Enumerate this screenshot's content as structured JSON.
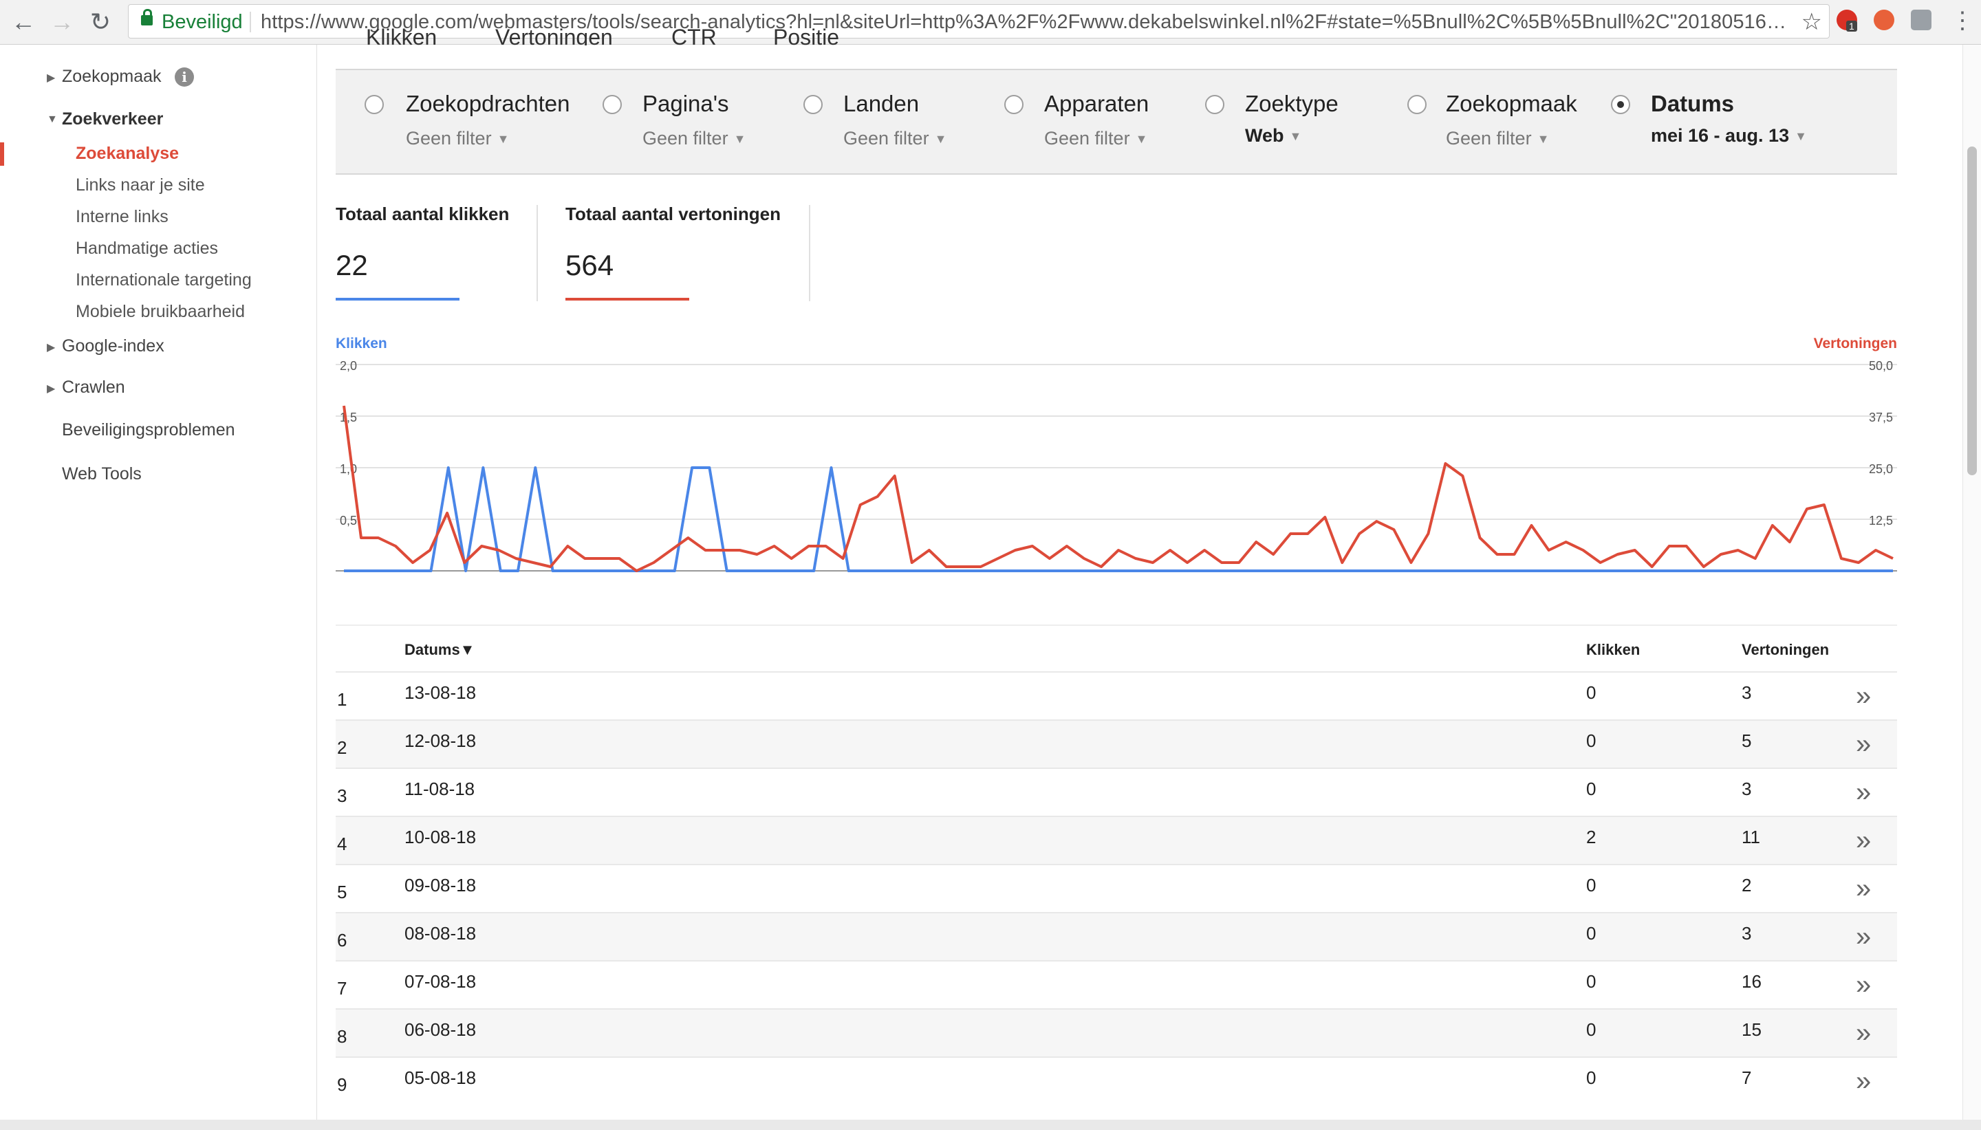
{
  "browser": {
    "back_icon": "back-arrow-icon",
    "forward_icon": "forward-arrow-icon",
    "reload_icon": "reload-icon",
    "secure_label": "Beveiligd",
    "url": "https://www.google.com/webmasters/tools/search-analytics?hl=nl&siteUrl=http%3A%2F%2Fwww.dekabelswinkel.nl%2F#state=%5Bnull%2C%5B%5Bnull%2C\"20180516…",
    "extension_badge": "1"
  },
  "sidebar": {
    "items": [
      {
        "label": "Zoekopmaak",
        "expandable": true
      },
      {
        "label": "Zoekverkeer",
        "expanded": true,
        "children": [
          "Zoekanalyse",
          "Links naar je site",
          "Interne links",
          "Handmatige acties",
          "Internationale targeting",
          "Mobiele bruikbaarheid"
        ]
      },
      {
        "label": "Google-index",
        "expandable": true
      },
      {
        "label": "Crawlen",
        "expandable": true
      },
      {
        "label": "Beveiligingsproblemen"
      },
      {
        "label": "Web Tools"
      }
    ],
    "active_child": "Zoekanalyse",
    "info_glyph": "i"
  },
  "metric_checkboxes": [
    "Klikken",
    "Vertoningen",
    "CTR",
    "Positie"
  ],
  "filters": [
    {
      "label": "Zoekopdrachten",
      "value": "Geen filter"
    },
    {
      "label": "Pagina's",
      "value": "Geen filter"
    },
    {
      "label": "Landen",
      "value": "Geen filter"
    },
    {
      "label": "Apparaten",
      "value": "Geen filter"
    },
    {
      "label": "Zoektype",
      "value": "Web"
    },
    {
      "label": "Zoekopmaak",
      "value": "Geen filter"
    },
    {
      "label": "Datums",
      "value": "mei 16 - aug. 13",
      "selected": true
    }
  ],
  "metrics": {
    "clicks_label": "Totaal aantal klikken",
    "clicks_value": "22",
    "impressions_label": "Totaal aantal vertoningen",
    "impressions_value": "564"
  },
  "chart_data": {
    "type": "line",
    "y_left_label": "Klikken",
    "y_right_label": "Vertoningen",
    "y_left_ticks": [
      "0,5",
      "1,0",
      "1,5",
      "2,0"
    ],
    "y_right_ticks": [
      "12,5",
      "25,0",
      "37,5",
      "50,0"
    ],
    "ylim_left": [
      0,
      2
    ],
    "ylim_right": [
      0,
      50
    ],
    "x_start": "2018-05-16",
    "x_end": "2018-08-13",
    "colors": {
      "clicks": "#4a86e8",
      "impressions": "#dd4b39"
    },
    "series": [
      {
        "name": "Klikken",
        "values": [
          0,
          0,
          0,
          0,
          0,
          0,
          1,
          0,
          1,
          0,
          0,
          1,
          0,
          0,
          0,
          0,
          0,
          0,
          0,
          0,
          1,
          1,
          0,
          0,
          0,
          0,
          0,
          0,
          1,
          0,
          0,
          0,
          0,
          0,
          0,
          0,
          0,
          0,
          0,
          0,
          0,
          0,
          0,
          0,
          0,
          0,
          0,
          0,
          0,
          0,
          0,
          0,
          0,
          0,
          0,
          0,
          0,
          0,
          0,
          0,
          0,
          0,
          0,
          0,
          0,
          0,
          0,
          0,
          0,
          0,
          0,
          0,
          0,
          0,
          0,
          0,
          0,
          0,
          0,
          0,
          0,
          0,
          0,
          0,
          0,
          0,
          0,
          0,
          0,
          0
        ]
      },
      {
        "name": "Vertoningen",
        "values": [
          40,
          8,
          8,
          6,
          2,
          5,
          14,
          2,
          6,
          5,
          3,
          2,
          1,
          6,
          3,
          3,
          3,
          0,
          2,
          5,
          8,
          5,
          5,
          5,
          4,
          6,
          3,
          6,
          6,
          3,
          16,
          18,
          23,
          2,
          5,
          1,
          1,
          1,
          3,
          5,
          6,
          3,
          6,
          3,
          1,
          5,
          3,
          2,
          5,
          2,
          5,
          2,
          2,
          7,
          4,
          9,
          9,
          13,
          2,
          9,
          12,
          10,
          2,
          9,
          26,
          23,
          8,
          4,
          4,
          11,
          5,
          7,
          5,
          2,
          4,
          5,
          1,
          6,
          6,
          1,
          4,
          5,
          3,
          11,
          7,
          15,
          16,
          3,
          2,
          5,
          3
        ]
      }
    ]
  },
  "table": {
    "headers": {
      "date": "Datums▼",
      "clicks": "Klikken",
      "impressions": "Vertoningen"
    },
    "rows": [
      {
        "idx": "1",
        "date": "13-08-18",
        "clicks": "0",
        "impressions": "3"
      },
      {
        "idx": "2",
        "date": "12-08-18",
        "clicks": "0",
        "impressions": "5"
      },
      {
        "idx": "3",
        "date": "11-08-18",
        "clicks": "0",
        "impressions": "3"
      },
      {
        "idx": "4",
        "date": "10-08-18",
        "clicks": "2",
        "impressions": "11"
      },
      {
        "idx": "5",
        "date": "09-08-18",
        "clicks": "0",
        "impressions": "2"
      },
      {
        "idx": "6",
        "date": "08-08-18",
        "clicks": "0",
        "impressions": "3"
      },
      {
        "idx": "7",
        "date": "07-08-18",
        "clicks": "0",
        "impressions": "16"
      },
      {
        "idx": "8",
        "date": "06-08-18",
        "clicks": "0",
        "impressions": "15"
      },
      {
        "idx": "9",
        "date": "05-08-18",
        "clicks": "0",
        "impressions": "7"
      }
    ],
    "more_glyph": "»"
  }
}
